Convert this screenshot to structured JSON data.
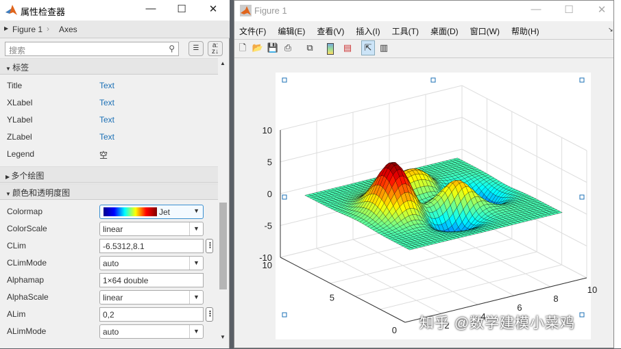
{
  "inspector": {
    "title": "属性检查器",
    "breadcrumb": [
      "Figure 1",
      "Axes"
    ],
    "search_placeholder": "搜索",
    "sections": {
      "labels": "标签",
      "multi_plot": "多个绘图",
      "color_alpha": "颜色和透明度图"
    },
    "label_props": [
      {
        "name": "Title",
        "value": "Text"
      },
      {
        "name": "XLabel",
        "value": "Text"
      },
      {
        "name": "YLabel",
        "value": "Text"
      },
      {
        "name": "ZLabel",
        "value": "Text"
      },
      {
        "name": "Legend",
        "value": "空"
      }
    ],
    "color_props": [
      {
        "name": "Colormap",
        "value": "Jet"
      },
      {
        "name": "ColorScale",
        "value": "linear"
      },
      {
        "name": "CLim",
        "value": "-6.5312,8.1"
      },
      {
        "name": "CLimMode",
        "value": "auto"
      },
      {
        "name": "Alphamap",
        "value": "1×64 double"
      },
      {
        "name": "AlphaScale",
        "value": "linear"
      },
      {
        "name": "ALim",
        "value": "0,2"
      },
      {
        "name": "ALimMode",
        "value": "auto"
      }
    ]
  },
  "figure": {
    "title": "Figure 1",
    "menu": [
      "文件(F)",
      "编辑(E)",
      "查看(V)",
      "插入(I)",
      "工具(T)",
      "桌面(D)",
      "窗口(W)",
      "帮助(H)"
    ]
  },
  "chart_data": {
    "type": "surface",
    "function": "peaks",
    "colormap": "jet",
    "zticks": [
      "10",
      "5",
      "0",
      "-5",
      "-10"
    ],
    "xticks": [
      "2",
      "4",
      "6",
      "8",
      "10"
    ],
    "yticks": [
      "10",
      "5",
      "0"
    ],
    "zlim": [
      -10,
      10
    ],
    "xlim": [
      0,
      10
    ],
    "ylim": [
      0,
      10
    ]
  },
  "watermark": "知乎 @数学建模小菜鸡"
}
